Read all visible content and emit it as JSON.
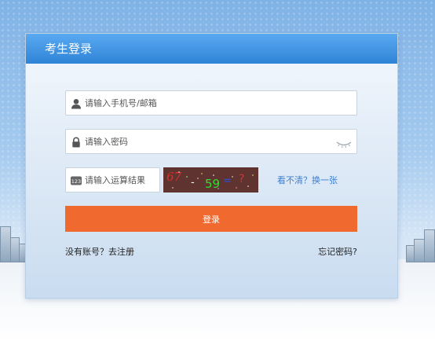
{
  "panel": {
    "title": "考生登录"
  },
  "form": {
    "account": {
      "placeholder": "请输入手机号/邮箱",
      "value": ""
    },
    "password": {
      "placeholder": "请输入密码",
      "value": ""
    },
    "captcha": {
      "placeholder": "请输入运算结果",
      "value": "",
      "icon_text": "123",
      "image_text": {
        "first": "67",
        "op": "-",
        "second": "59",
        "eq": "=",
        "q": "?"
      },
      "refresh_label": "看不清？换一张"
    },
    "login_label": "登录",
    "register_label": "没有账号？去注册",
    "forgot_label": "忘记密码?"
  },
  "colors": {
    "header": "#3f93e0",
    "login_button": "#f06a30",
    "link": "#3c7fd0"
  },
  "icons": {
    "account": "user-icon",
    "password": "lock-icon",
    "captcha": "numeric-123-icon",
    "password_toggle": "eye-closed-icon"
  }
}
